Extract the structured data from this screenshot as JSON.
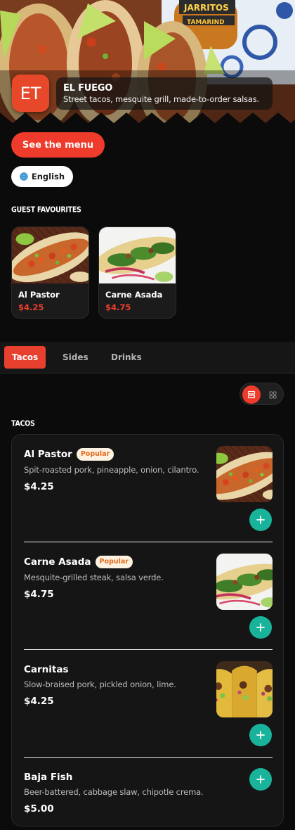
{
  "restaurant": {
    "initials": "ET",
    "name": "EL FUEGO",
    "tagline": "Street tacos, mesquite grill, made-to-order salsas."
  },
  "hero": {
    "bottle_label_top": "JARRITOS",
    "bottle_label_bottom": "TAMARIND"
  },
  "cta_label": "See the menu",
  "language": {
    "label": "English",
    "icon": "globe-icon"
  },
  "favourites": {
    "title": "GUEST FAVOURITES",
    "items": [
      {
        "name": "Al Pastor",
        "price": "$4.25"
      },
      {
        "name": "Carne Asada",
        "price": "$4.75"
      }
    ]
  },
  "tabs": [
    {
      "label": "Tacos",
      "active": true
    },
    {
      "label": "Sides",
      "active": false
    },
    {
      "label": "Drinks",
      "active": false
    }
  ],
  "view_toggle": {
    "selected": "list",
    "options": [
      "list-view-icon",
      "grid-view-icon"
    ]
  },
  "menu": {
    "section_title": "TACOS",
    "items": [
      {
        "name": "Al Pastor",
        "badge": "Popular",
        "description": "Spit-roasted pork, pineapple, onion, cilantro.",
        "price": "$4.25"
      },
      {
        "name": "Carne Asada",
        "badge": "Popular",
        "description": "Mesquite-grilled steak, salsa verde.",
        "price": "$4.75"
      },
      {
        "name": "Carnitas",
        "badge": "",
        "description": "Slow-braised pork, pickled onion, lime.",
        "price": "$4.25"
      },
      {
        "name": "Baja Fish",
        "badge": "",
        "description": "Beer-battered, cabbage slaw, chipotle crema.",
        "price": "$5.00"
      }
    ]
  },
  "colors": {
    "accent": "#ee3b2b",
    "add_button": "#19b39b",
    "badge_bg": "#fdf2e2",
    "badge_text": "#e46a1c",
    "background": "#0b0b0b"
  }
}
